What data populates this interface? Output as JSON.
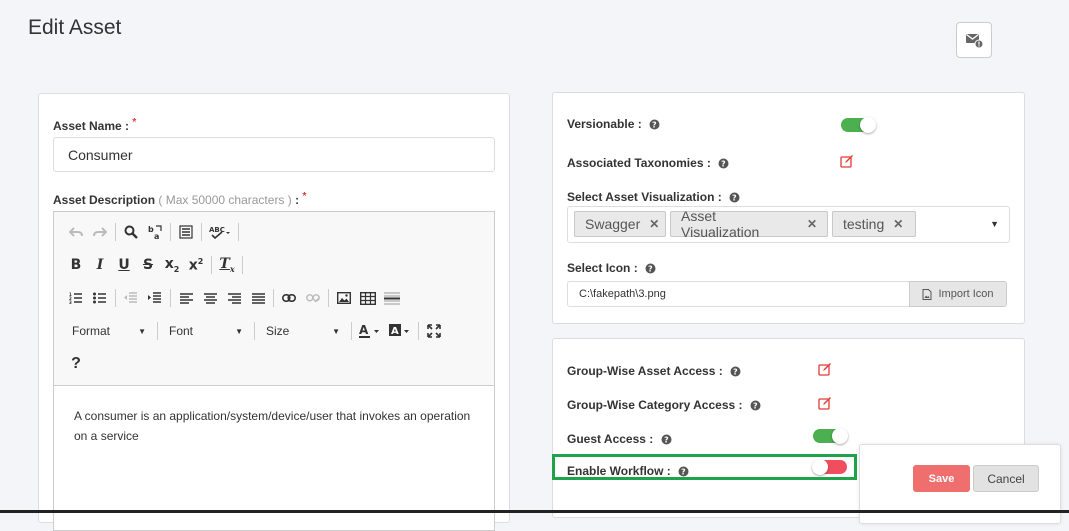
{
  "page": {
    "title": "Edit Asset"
  },
  "header": {
    "mail_icon": "mail-alert-icon"
  },
  "asset_name": {
    "label": "Asset Name :",
    "required_mark": "*",
    "value": "Consumer"
  },
  "asset_description": {
    "label": "Asset Description",
    "hint": "( Max 50000 characters )",
    "colon": ":",
    "required_mark": "*",
    "content": "A consumer is an application/system/device/user that invokes an operation on a service"
  },
  "editor_toolbar": {
    "format_label": "Format",
    "font_label": "Font",
    "size_label": "Size",
    "help_label": "?"
  },
  "settings": {
    "versionable": {
      "label": "Versionable :",
      "state": "on"
    },
    "associated_taxonomies": {
      "label": "Associated Taxonomies :"
    },
    "asset_visualization": {
      "label": "Select Asset Visualization :",
      "tags": [
        "Swagger",
        "Asset Visualization",
        "testing"
      ]
    },
    "select_icon": {
      "label": "Select Icon :",
      "value": "C:\\fakepath\\3.png",
      "button_label": "Import Icon"
    }
  },
  "access": {
    "group_asset_access": {
      "label": "Group-Wise Asset Access :"
    },
    "group_category_access": {
      "label": "Group-Wise Category Access :"
    },
    "guest_access": {
      "label": "Guest Access :",
      "state": "on"
    },
    "enable_workflow": {
      "label": "Enable Workflow :",
      "state": "off"
    }
  },
  "actions": {
    "save_label": "Save",
    "cancel_label": "Cancel"
  },
  "colors": {
    "toggle_on": "#4caf50",
    "toggle_off": "#f04e5e",
    "save": "#ef6e6e",
    "highlight": "#1ea34a"
  }
}
